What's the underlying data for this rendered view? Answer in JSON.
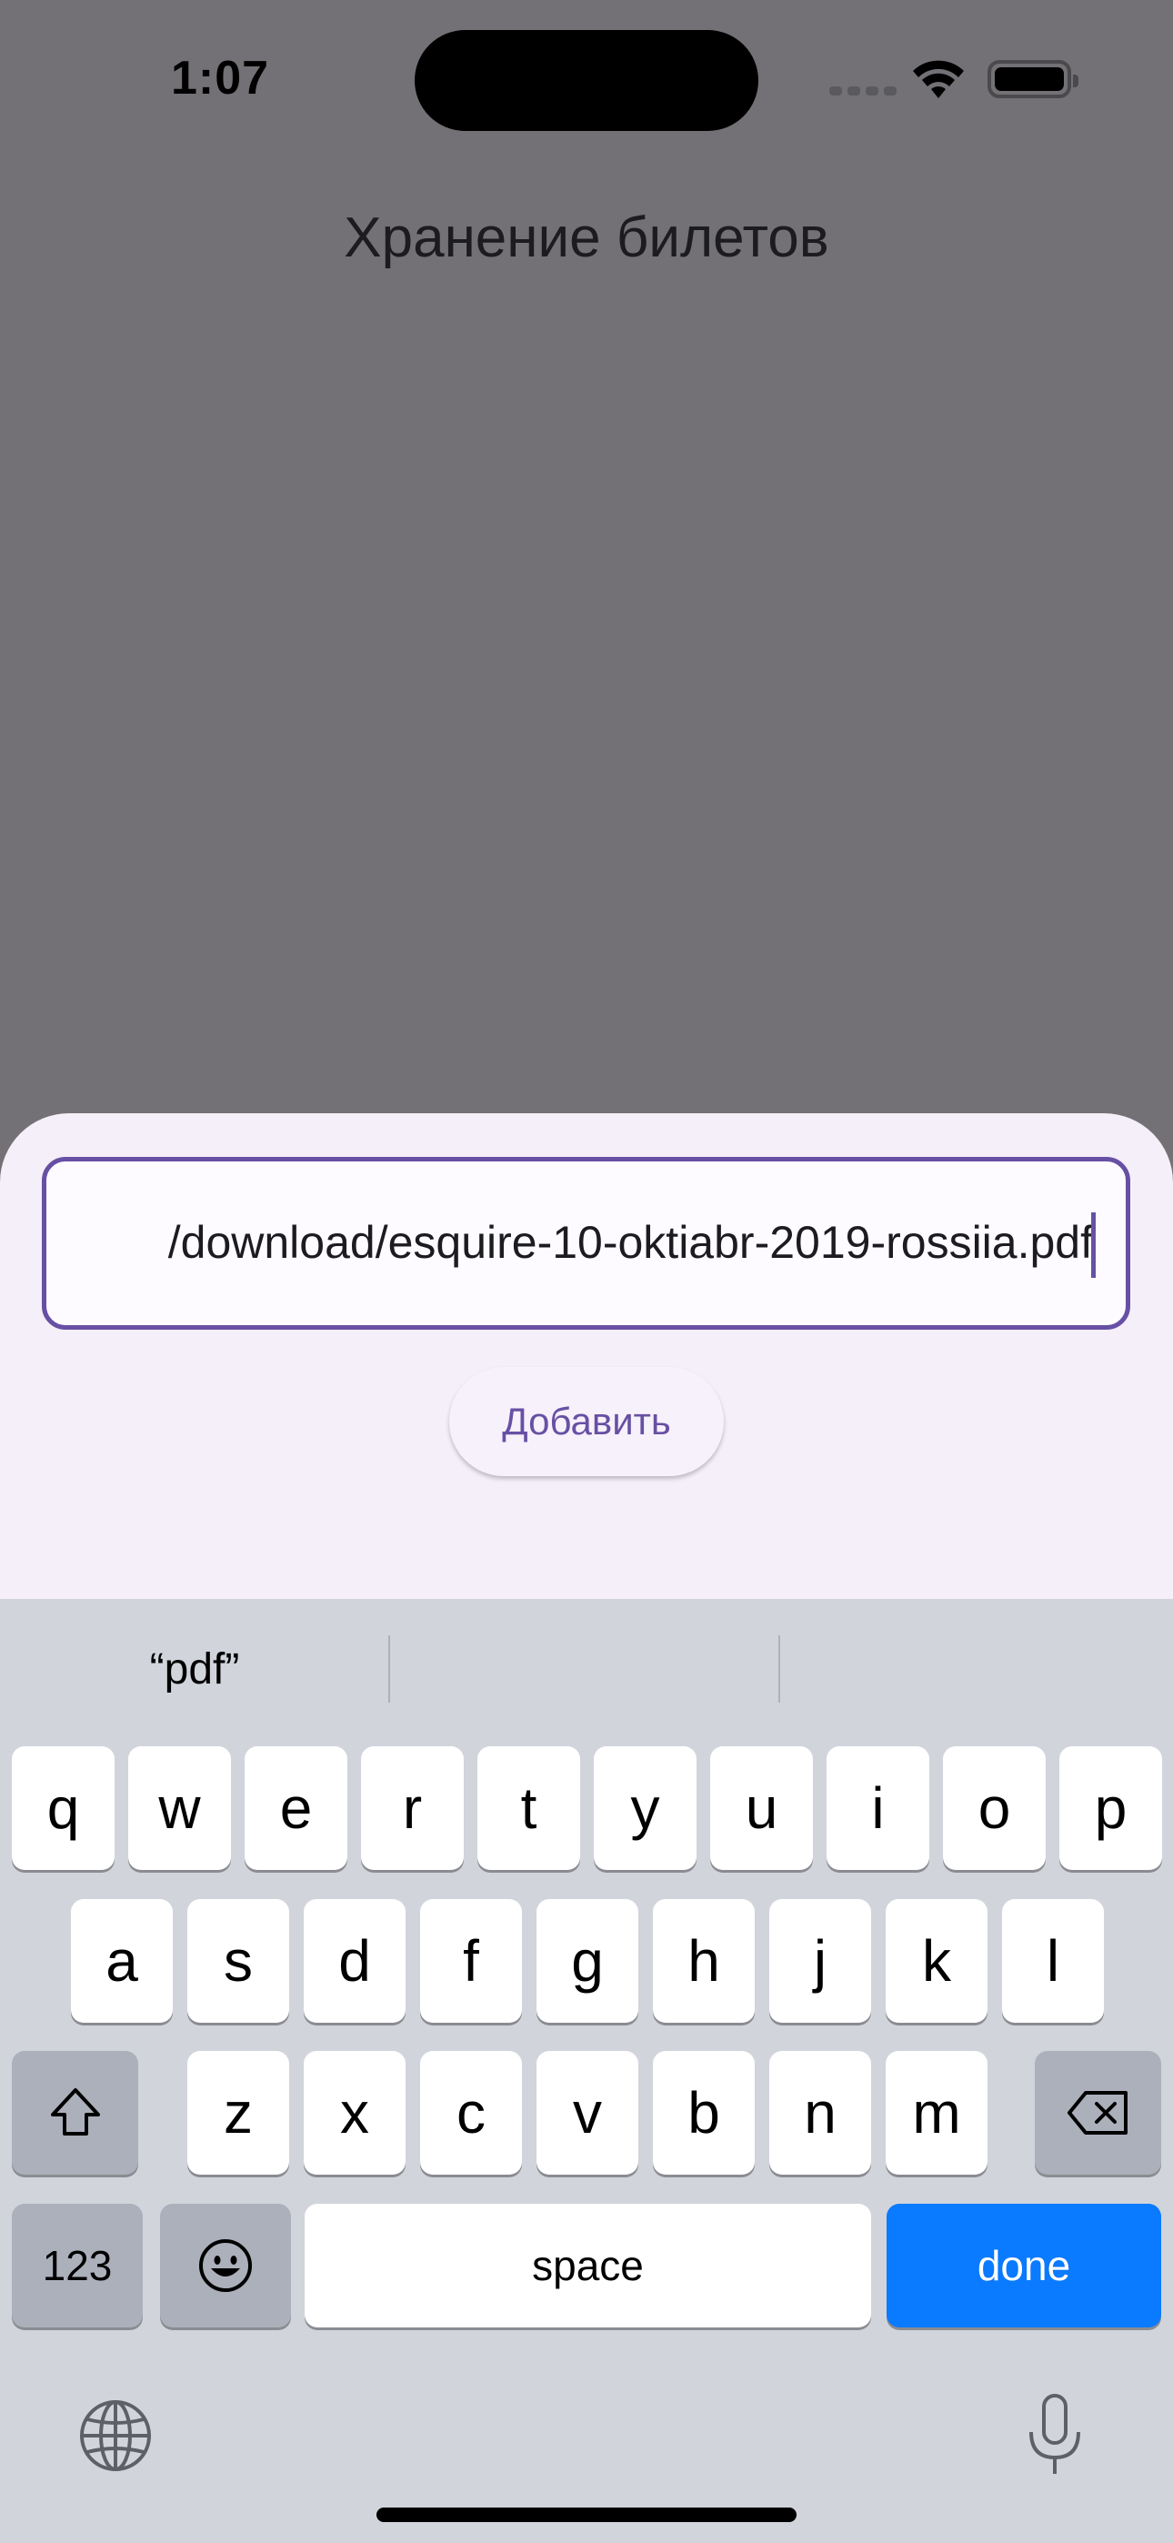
{
  "status_bar": {
    "time": "1:07"
  },
  "header": {
    "title": "Хранение билетов"
  },
  "sheet": {
    "url_value": "/download/esquire-10-oktiabr-2019-rossiia.pdf",
    "add_label": "Добавить"
  },
  "keyboard": {
    "suggestions": [
      "“pdf”",
      "",
      ""
    ],
    "row1": [
      "q",
      "w",
      "e",
      "r",
      "t",
      "y",
      "u",
      "i",
      "o",
      "p"
    ],
    "row2": [
      "a",
      "s",
      "d",
      "f",
      "g",
      "h",
      "j",
      "k",
      "l"
    ],
    "row3": [
      "z",
      "x",
      "c",
      "v",
      "b",
      "n",
      "m"
    ],
    "numbers_label": "123",
    "space_label": "space",
    "done_label": "done"
  },
  "icons": [
    "wifi-icon",
    "battery-icon",
    "shift-icon",
    "backspace-icon",
    "emoji-icon",
    "globe-icon",
    "microphone-icon"
  ],
  "colors": {
    "accent": "#6750a4",
    "done_key": "#0a7aff",
    "keyboard_bg": "#d1d4db",
    "scrim": "#737175",
    "sheet_bg": "#f4eff8"
  }
}
